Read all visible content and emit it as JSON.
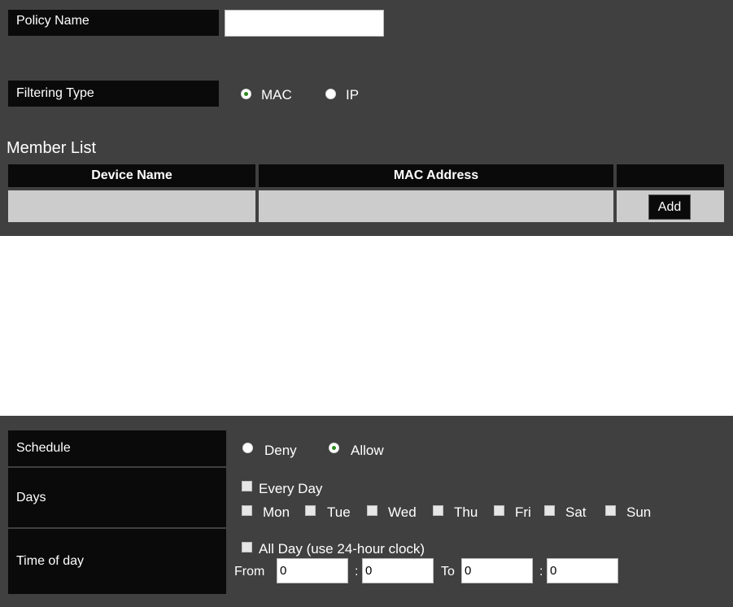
{
  "policy": {
    "name_label": "Policy Name",
    "name_value": "",
    "filter_label": "Filtering Type",
    "filter_options": [
      {
        "label": "MAC",
        "checked": true
      },
      {
        "label": "IP",
        "checked": false
      }
    ]
  },
  "member_list": {
    "title": "Member List",
    "columns": [
      "Device Name",
      "MAC Address",
      ""
    ],
    "row": {
      "device_name": "",
      "mac_address": ""
    },
    "add_label": "Add"
  },
  "schedule": {
    "schedule_label": "Schedule",
    "options": [
      {
        "label": "Deny",
        "checked": false
      },
      {
        "label": "Allow",
        "checked": true
      }
    ],
    "days_label": "Days",
    "every_day_label": "Every Day",
    "days": [
      "Mon",
      "Tue",
      "Wed",
      "Thu",
      "Fri",
      "Sat",
      "Sun"
    ],
    "time_label": "Time of day",
    "all_day_label": "All Day (use 24-hour clock)",
    "from_label": "From",
    "to_label": "To",
    "colon": ":",
    "from_hour": "0",
    "from_minute": "0",
    "to_hour": "0",
    "to_minute": "0"
  },
  "colors": {
    "panel": "#404040",
    "label_bg": "#0a0a0a",
    "cell_bg": "#cccccc",
    "radio_dot": "#2e8b1e"
  }
}
